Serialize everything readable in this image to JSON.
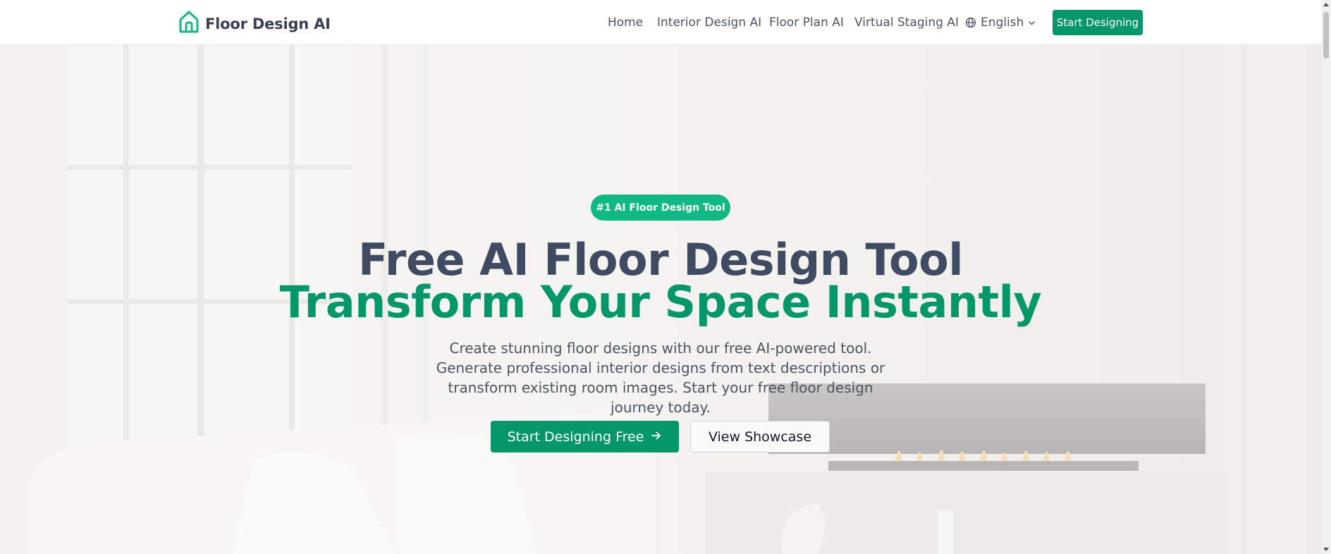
{
  "header": {
    "brand": "Floor Design AI",
    "nav": [
      {
        "label": "Home"
      },
      {
        "label": "Interior Design AI"
      },
      {
        "label": "Floor Plan AI"
      },
      {
        "label": "Virtual Staging AI"
      }
    ],
    "language": "English",
    "cta": "Start Designing"
  },
  "hero": {
    "badge": "#1 AI Floor Design Tool",
    "headline_line1": "Free AI Floor Design Tool",
    "headline_line2": "Transform Your Space Instantly",
    "subtitle": "Create stunning floor designs with our free AI-powered tool. Generate professional interior designs from text descriptions or transform existing room images. Start your free floor design journey today.",
    "primary_button": "Start Designing Free",
    "secondary_button": "View Showcase"
  },
  "colors": {
    "brand_green": "#059669",
    "badge_green": "#10b981",
    "headline_slate": "#3f4b63",
    "text_gray": "#4b5563"
  },
  "icons": {
    "logo": "house-icon",
    "language": "globe-icon",
    "dropdown": "chevron-down-icon",
    "primary_arrow": "arrow-right-icon"
  }
}
